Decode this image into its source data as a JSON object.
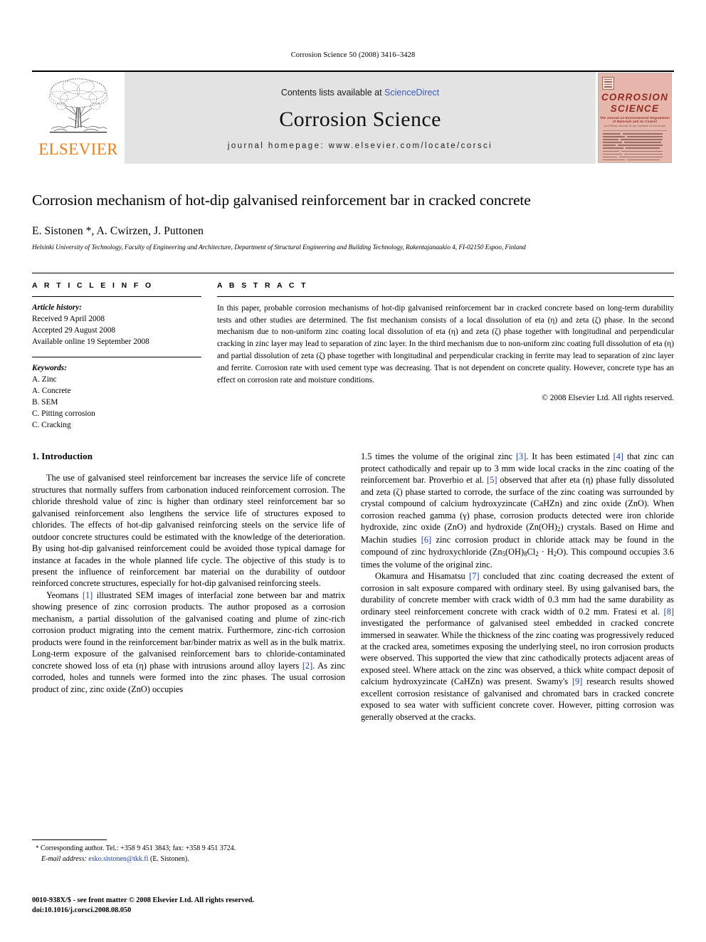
{
  "running_head": "Corrosion Science 50 (2008) 3416–3428",
  "masthead": {
    "publisher_word": "ELSEVIER",
    "contents_prefix": "Contents lists available at ",
    "contents_link": "ScienceDirect",
    "journal_title": "Corrosion Science",
    "homepage": "journal homepage: www.elsevier.com/locate/corsci",
    "cover": {
      "line1": "CORROSION",
      "line2": "SCIENCE",
      "subtitle": "The Journal on Environmental Degradation of Materials and its Control",
      "subtitle2": "an Official Journal of the Institute of Corrosion"
    }
  },
  "article": {
    "title": "Corrosion mechanism of hot-dip galvanised reinforcement bar in cracked concrete",
    "authors": "E. Sistonen *, A. Cwirzen, J. Puttonen",
    "affiliation": "Helsinki University of Technology, Faculty of Engineering and Architecture, Department of Structural Engineering and Building Technology, Rakentajanaukio 4, FI-02150 Espoo, Finland"
  },
  "info": {
    "heading": "A R T I C L E   I N F O",
    "history_label": "Article history:",
    "history": [
      "Received 9 April 2008",
      "Accepted 29 August 2008",
      "Available online 19 September 2008"
    ],
    "keywords_label": "Keywords:",
    "keywords": [
      "A. Zinc",
      "A. Concrete",
      "B. SEM",
      "C. Pitting corrosion",
      "C. Cracking"
    ]
  },
  "abstract": {
    "heading": "A B S T R A C T",
    "text": "In this paper, probable corrosion mechanisms of hot-dip galvanised reinforcement bar in cracked concrete based on long-term durability tests and other studies are determined. The fist mechanism consists of a local dissolution of eta (η) and zeta (ζ) phase. In the second mechanism due to non-uniform zinc coating local dissolution of eta (η) and zeta (ζ) phase together with longitudinal and perpendicular cracking in zinc layer may lead to separation of zinc layer. In the third mechanism due to non-uniform zinc coating full dissolution of eta (η) and partial dissolution of zeta (ζ) phase together with longitudinal and perpendicular cracking in ferrite may lead to separation of zinc layer and ferrite. Corrosion rate with used cement type was decreasing. That is not dependent on concrete quality. However, concrete type has an effect on corrosion rate and moisture conditions.",
    "copyright": "© 2008 Elsevier Ltd. All rights reserved."
  },
  "body": {
    "section1_heading": "1. Introduction",
    "left_paragraph_1": "The use of galvanised steel reinforcement bar increases the service life of concrete structures that normally suffers from carbonation induced reinforcement corrosion. The chloride threshold value of zinc is higher than ordinary steel reinforcement bar so galvanised reinforcement also lengthens the service life of structures exposed to chlorides. The effects of hot-dip galvanised reinforcing steels on the service life of outdoor concrete structures could be estimated with the knowledge of the deterioration. By using hot-dip galvanised reinforcement could be avoided those typical damage for instance at facades in the whole planned life cycle. The objective of this study is to present the influence of reinforcement bar material on the durability of outdoor reinforced concrete structures, especially for hot-dip galvanised reinforcing steels.",
    "left_paragraph_2_a": "Yeomans ",
    "left_ref_1": "[1]",
    "left_paragraph_2_b": " illustrated SEM images of interfacial zone between bar and matrix showing presence of zinc corrosion products. The author proposed as a corrosion mechanism, a partial dissolution of the galvanised coating and plume of zinc-rich corrosion product migrating into the cement matrix. Furthermore, zinc-rich corrosion products were found in the reinforcement bar/binder matrix as well as in the bulk matrix. Long-term exposure of the galvanised reinforcement bars to chloride-contaminated concrete showed loss of eta (η) phase with intrusions around alloy layers ",
    "left_ref_2": "[2]",
    "left_paragraph_2_c": ". As zinc corroded, holes and tunnels were formed into the zinc phases. The usual corrosion product of zinc, zinc oxide (ZnO) occupies",
    "right_paragraph_1_a": "1.5 times the volume of the original zinc ",
    "right_ref_3": "[3]",
    "right_paragraph_1_b": ". It has been estimated ",
    "right_ref_4": "[4]",
    "right_paragraph_1_c": " that zinc can protect cathodically and repair up to 3 mm wide local cracks in the zinc coating of the reinforcement bar. Proverbio et al. ",
    "right_ref_5": "[5]",
    "right_paragraph_1_d": " observed that after eta (η) phase fully dissoluted and zeta (ζ) phase started to corrode, the surface of the zinc coating was surrounded by crystal compound of calcium hydroxyzincate (CaHZn) and zinc oxide (ZnO). When corrosion reached gamma (γ) phase, corrosion products detected were iron chloride hydroxide, zinc oxide (ZnO) and hydroxide (Zn(OH)",
    "right_paragraph_1_e": ") crystals. Based on Hime and Machin studies ",
    "right_ref_6": "[6]",
    "right_paragraph_1_f": " zinc corrosion product in chloride attack may be found in the compound of zinc hydroxychloride (Zn",
    "right_paragraph_1_g": "(OH)",
    "right_paragraph_1_h": "Cl",
    "right_paragraph_1_i": " · H",
    "right_paragraph_1_j": "O). This compound occupies 3.6 times the volume of the original zinc.",
    "right_paragraph_2_a": "Okamura and Hisamatsu ",
    "right_ref_7": "[7]",
    "right_paragraph_2_b": " concluded that zinc coating decreased the extent of corrosion in salt exposure compared with ordinary steel. By using galvanised bars, the durability of concrete member with crack width of 0.3 mm had the same durability as ordinary steel reinforcement concrete with crack width of 0.2 mm. Fratesi et al. ",
    "right_ref_8": "[8]",
    "right_paragraph_2_c": " investigated the performance of galvanised steel embedded in cracked concrete immersed in seawater. While the thickness of the zinc coating was progressively reduced at the cracked area, sometimes exposing the underlying steel, no iron corrosion products were observed. This supported the view that zinc cathodically protects adjacent areas of exposed steel. Where attack on the zinc was observed, a thick white compact deposit of calcium hydroxyzincate (CaHZn) was present. Swamy's ",
    "right_ref_9": "[9]",
    "right_paragraph_2_d": " research results showed excellent corrosion resistance of galvanised and chromated bars in cracked concrete exposed to sea water with sufficient concrete cover. However, pitting corrosion was generally observed at the cracks."
  },
  "footnote": {
    "marker": "*",
    "corresponding": "Corresponding author. Tel.: +358 9 451 3843; fax: +358 9 451 3724.",
    "email_label": "E-mail address:",
    "email": "esko.sistonen@tkk.fi",
    "email_owner": "(E. Sistonen)."
  },
  "footer": {
    "issn_line": "0010-938X/$ - see front matter © 2008 Elsevier Ltd. All rights reserved.",
    "doi_line": "doi:10.1016/j.corsci.2008.08.050"
  }
}
